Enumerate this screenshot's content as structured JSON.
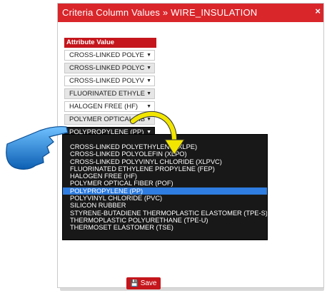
{
  "dialog": {
    "title": "Criteria Column Values » WIRE_INSULATION",
    "close_glyph": "×"
  },
  "table": {
    "header": "Attribute Value",
    "rows": [
      {
        "value": "CROSS-LINKED POLYE",
        "arrow": "▼"
      },
      {
        "value": "CROSS-LINKED POLYC",
        "arrow": "▼"
      },
      {
        "value": "CROSS-LINKED POLYV",
        "arrow": "▼"
      },
      {
        "value": "FLUORINATED ETHYLE",
        "arrow": "▼"
      },
      {
        "value": "HALOGEN FREE (HF)",
        "arrow": "▼"
      },
      {
        "value": "POLYMER OPTICAL FIBE",
        "arrow": "▼"
      },
      {
        "value": "POLYPROPYLENE (PP)",
        "arrow": "▼"
      }
    ]
  },
  "dropdown": {
    "options": [
      "",
      "CROSS-LINKED POLYETHYLENE (XLPE)",
      "CROSS-LINKED POLYOLEFIN (XLPO)",
      "CROSS-LINKED POLYVINYL CHLORIDE (XLPVC)",
      "FLUORINATED ETHYLENE PROPYLENE (FEP)",
      "HALOGEN FREE (HF)",
      "POLYMER OPTICAL FIBER (POF)",
      "POLYPROPYLENE (PP)",
      "POLYVINYL CHLORIDE (PVC)",
      "SILICON RUBBER",
      "STYRENE-BUTADIENE THERMOPLASTIC ELASTOMER (TPE-S)",
      "THERMOPLASTIC POLYURETHANE (TPE-U)",
      "THERMOSET ELASTOMER (TSE)"
    ],
    "selected": "POLYPROPYLENE (PP)"
  },
  "footer": {
    "save_label": "Save",
    "save_icon": "floppy-disk-icon"
  },
  "colors": {
    "accent_red": "#d9262b",
    "dropdown_bg": "#181818",
    "selection_blue": "#2f7de0",
    "annotation_yellow": "#f2e600",
    "pointer_blue": "#1e88d8"
  }
}
